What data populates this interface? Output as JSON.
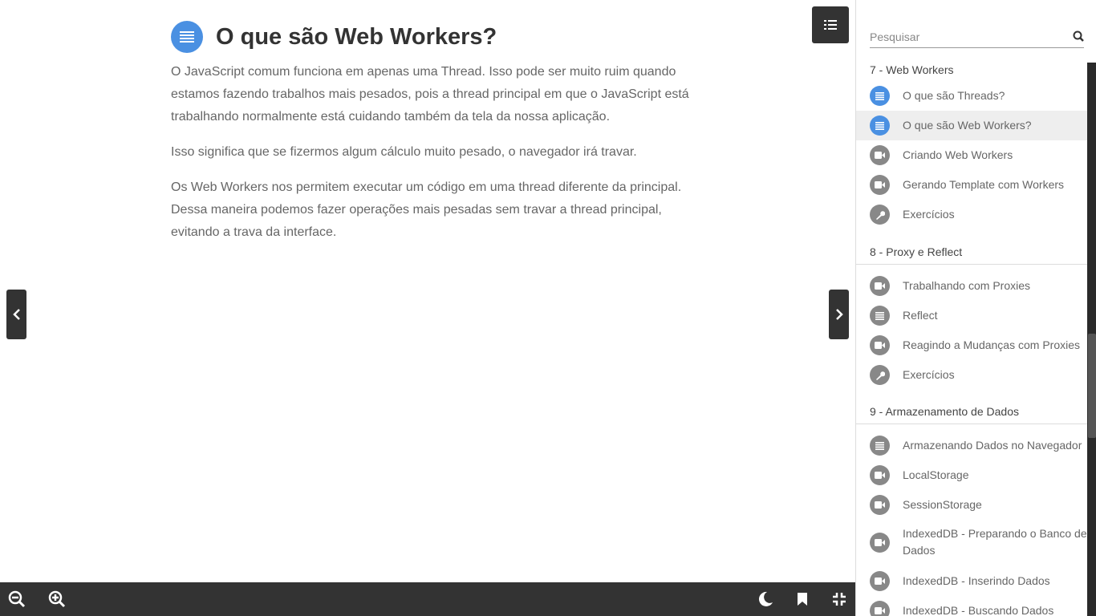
{
  "lesson": {
    "title": "O que são Web Workers?",
    "icon": "list-icon",
    "paragraphs": [
      "O JavaScript comum funciona em apenas uma Thread. Isso pode ser muito ruim quando estamos fazendo trabalhos mais pesados, pois a thread principal em que o JavaScript está trabalhando normalmente está cuidando também da tela da nossa aplicação.",
      "Isso significa que se fizermos algum cálculo muito pesado, o navegador irá travar.",
      "Os Web Workers nos permitem executar um código em uma thread diferente da principal. Dessa maneira podemos fazer operações mais pesadas sem travar a thread principal, evitando a trava da interface."
    ]
  },
  "search": {
    "placeholder": "Pesquisar"
  },
  "sections": [
    {
      "title": "7 - Web Workers",
      "items": [
        {
          "label": "O que são Threads?",
          "type": "text",
          "icon": "list-icon",
          "color": "#4a90e2"
        },
        {
          "label": "O que são Web Workers?",
          "type": "text",
          "icon": "list-icon",
          "color": "#4a90e2",
          "active": true
        },
        {
          "label": "Criando Web Workers",
          "type": "video",
          "icon": "video-icon"
        },
        {
          "label": "Gerando Template com Workers",
          "type": "video",
          "icon": "video-icon"
        },
        {
          "label": "Exercícios",
          "type": "exercise",
          "icon": "wrench-icon"
        }
      ]
    },
    {
      "title": "8 - Proxy e Reflect",
      "items": [
        {
          "label": "Trabalhando com Proxies",
          "type": "video",
          "icon": "video-icon"
        },
        {
          "label": "Reflect",
          "type": "text",
          "icon": "list-icon"
        },
        {
          "label": "Reagindo a Mudanças com Proxies",
          "type": "video",
          "icon": "video-icon"
        },
        {
          "label": "Exercícios",
          "type": "exercise",
          "icon": "wrench-icon"
        }
      ]
    },
    {
      "title": "9 - Armazenamento de Dados",
      "items": [
        {
          "label": "Armazenando Dados no Navegador",
          "type": "text",
          "icon": "list-icon"
        },
        {
          "label": "LocalStorage",
          "type": "video",
          "icon": "video-icon"
        },
        {
          "label": "SessionStorage",
          "type": "video",
          "icon": "video-icon"
        },
        {
          "label": "IndexedDB - Preparando o Banco de Dados",
          "type": "video",
          "icon": "video-icon"
        },
        {
          "label": "IndexedDB - Inserindo Dados",
          "type": "video",
          "icon": "video-icon"
        },
        {
          "label": "IndexedDB - Buscando Dados",
          "type": "video",
          "icon": "video-icon"
        }
      ]
    }
  ],
  "toolbar": {
    "left": [
      "zoom-out-icon",
      "zoom-in-icon"
    ],
    "right": [
      "moon-icon",
      "bookmark-icon",
      "exit-fullscreen-icon"
    ]
  },
  "colors": {
    "accent": "#4a90e2",
    "dark": "#333333",
    "muted_icon": "#888888"
  }
}
